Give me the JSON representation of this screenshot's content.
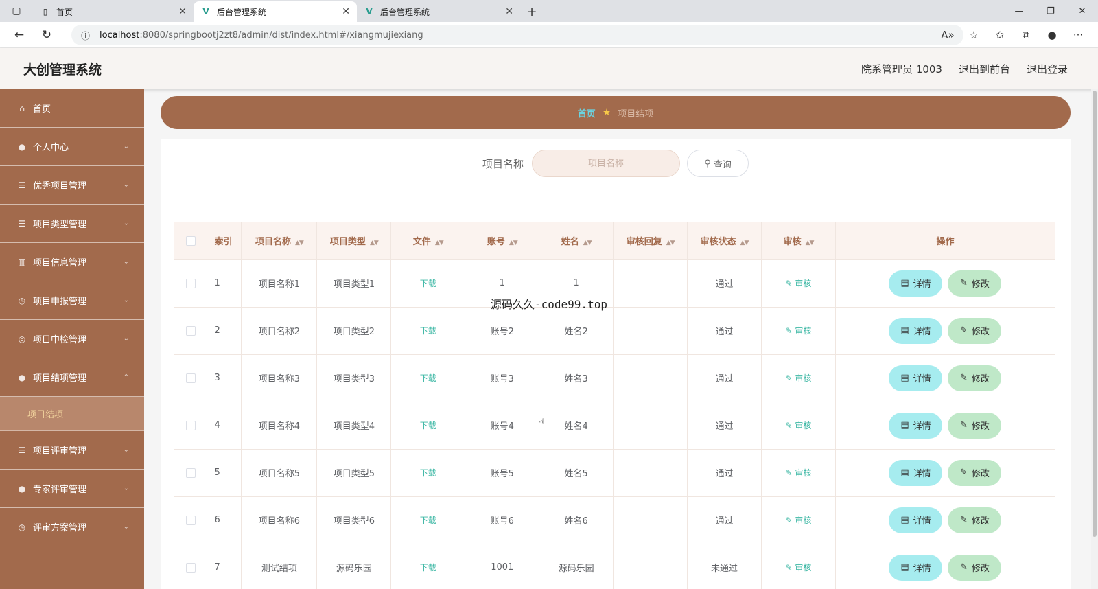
{
  "browser": {
    "tabs": [
      {
        "title": "首页",
        "icon": "page-icon"
      },
      {
        "title": "后台管理系统",
        "icon": "vue-icon",
        "active": true
      },
      {
        "title": "后台管理系统",
        "icon": "vue-icon"
      }
    ],
    "url_host": "localhost",
    "url_path": ":8080/springbootj2zt8/admin/dist/index.html#/xiangmujiexiang"
  },
  "header": {
    "title": "大创管理系统",
    "user": "院系管理员 1003",
    "to_front": "退出到前台",
    "logout": "退出登录"
  },
  "sidebar": {
    "items": [
      {
        "label": "首页",
        "icon": "home-icon"
      },
      {
        "label": "个人中心",
        "icon": "user-icon"
      },
      {
        "label": "优秀项目管理",
        "icon": "list-icon"
      },
      {
        "label": "项目类型管理",
        "icon": "list-icon"
      },
      {
        "label": "项目信息管理",
        "icon": "bar-icon"
      },
      {
        "label": "项目申报管理",
        "icon": "clock-icon"
      },
      {
        "label": "项目中检管理",
        "icon": "globe-icon"
      },
      {
        "label": "项目结项管理",
        "icon": "user-icon"
      },
      {
        "label": "项目评审管理",
        "icon": "list-icon"
      },
      {
        "label": "专家评审管理",
        "icon": "user-icon"
      },
      {
        "label": "评审方案管理",
        "icon": "clock-icon"
      }
    ],
    "active_sub": "项目结项"
  },
  "breadcrumb": {
    "home": "首页",
    "current": "项目结项"
  },
  "search": {
    "label": "项目名称",
    "placeholder": "项目名称",
    "button": "查询"
  },
  "table": {
    "columns": [
      "索引",
      "项目名称",
      "项目类型",
      "文件",
      "账号",
      "姓名",
      "审核回复",
      "审核状态",
      "审核",
      "操作"
    ],
    "download_label": "下载",
    "audit_label": "审核",
    "detail_label": "详情",
    "edit_label": "修改",
    "rows": [
      {
        "index": "1",
        "name": "项目名称1",
        "type": "项目类型1",
        "account": "1",
        "person": "1",
        "reply": "",
        "status": "通过"
      },
      {
        "index": "2",
        "name": "项目名称2",
        "type": "项目类型2",
        "account": "账号2",
        "person": "姓名2",
        "reply": "",
        "status": "通过"
      },
      {
        "index": "3",
        "name": "项目名称3",
        "type": "项目类型3",
        "account": "账号3",
        "person": "姓名3",
        "reply": "",
        "status": "通过"
      },
      {
        "index": "4",
        "name": "项目名称4",
        "type": "项目类型4",
        "account": "账号4",
        "person": "姓名4",
        "reply": "",
        "status": "通过"
      },
      {
        "index": "5",
        "name": "项目名称5",
        "type": "项目类型5",
        "account": "账号5",
        "person": "姓名5",
        "reply": "",
        "status": "通过"
      },
      {
        "index": "6",
        "name": "项目名称6",
        "type": "项目类型6",
        "account": "账号6",
        "person": "姓名6",
        "reply": "",
        "status": "通过"
      },
      {
        "index": "7",
        "name": "测试结项",
        "type": "源码乐园",
        "account": "1001",
        "person": "源码乐园",
        "reply": "",
        "status": "未通过"
      }
    ]
  },
  "overlay_text": "源码久久-code99.top"
}
